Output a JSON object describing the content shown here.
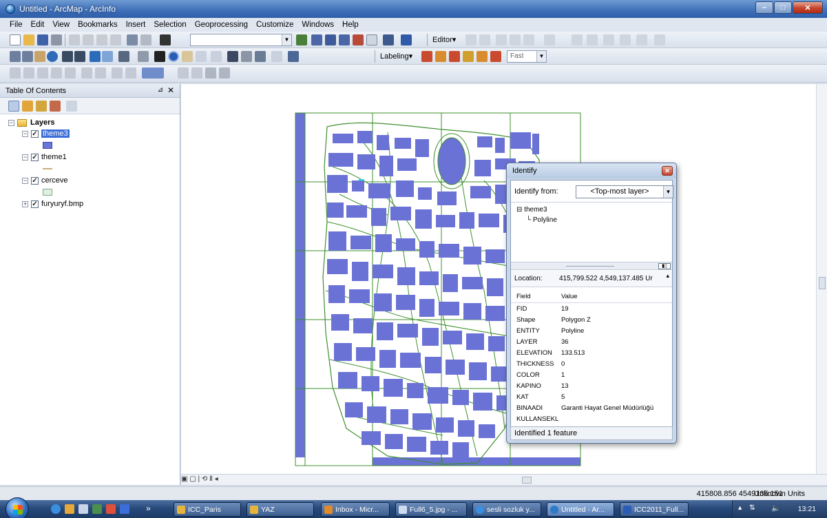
{
  "window": {
    "title": "Untitled - ArcMap - ArcInfo"
  },
  "menu": [
    "File",
    "Edit",
    "View",
    "Bookmarks",
    "Insert",
    "Selection",
    "Geoprocessing",
    "Customize",
    "Windows",
    "Help"
  ],
  "toolbar": {
    "editor_label": "Editor▾",
    "labeling_label": "Labeling▾",
    "quality_value": "Fast"
  },
  "toc": {
    "title": "Table Of Contents",
    "root": "Layers",
    "layers": [
      {
        "name": "theme3",
        "checked": true,
        "selected": true,
        "symbol_color": "#6a76d8"
      },
      {
        "name": "theme1",
        "checked": true,
        "selected": false,
        "symbol_color": "#c9b07a"
      },
      {
        "name": "cerceve",
        "checked": true,
        "selected": false,
        "symbol_color": "#dff0e0"
      },
      {
        "name": "furyuryf.bmp",
        "checked": true,
        "selected": false,
        "symbol_color": ""
      }
    ]
  },
  "map": {
    "polygon_color": "#6b72d6",
    "line_color": "#3e8f2e"
  },
  "statusbar": {
    "coords": "415808.856  4549135.151",
    "units": "Unknown Units"
  },
  "identify": {
    "title": "Identify",
    "from_label": "Identify from:",
    "from_value": "<Top-most layer>",
    "tree_layer": "theme3",
    "tree_feature": "Polyline",
    "location_label": "Location:",
    "location_value": "415,799.522  4,549,137.485 Ur",
    "field_header": "Field",
    "value_header": "Value",
    "rows": [
      {
        "field": "FID",
        "value": "19"
      },
      {
        "field": "Shape",
        "value": "Polygon Z"
      },
      {
        "field": "ENTITY",
        "value": "Polyline"
      },
      {
        "field": "LAYER",
        "value": "36"
      },
      {
        "field": "ELEVATION",
        "value": "133.513"
      },
      {
        "field": "THICKNESS",
        "value": "0"
      },
      {
        "field": "COLOR",
        "value": "1"
      },
      {
        "field": "KAPINO",
        "value": "13"
      },
      {
        "field": "KAT",
        "value": "5"
      },
      {
        "field": "BINAADI",
        "value": "Garanti Hayat Genel Müdürlüğü"
      },
      {
        "field": "KULLANSEKL",
        "value": ""
      }
    ],
    "status": "Identified 1 feature"
  },
  "taskbar": {
    "items": [
      {
        "label": "ICC_Paris",
        "icon": "folder-icon"
      },
      {
        "label": "YAZ",
        "icon": "folder-icon"
      },
      {
        "label": "Inbox - Micr...",
        "icon": "outlook-icon"
      },
      {
        "label": "Full6_5.jpg - ...",
        "icon": "image-icon"
      },
      {
        "label": "sesli sozluk y...",
        "icon": "ie-icon"
      },
      {
        "label": "Untitled - Ar...",
        "icon": "arcmap-icon"
      },
      {
        "label": "ICC2011_Full...",
        "icon": "doc-icon"
      }
    ],
    "clock": "13:21"
  }
}
